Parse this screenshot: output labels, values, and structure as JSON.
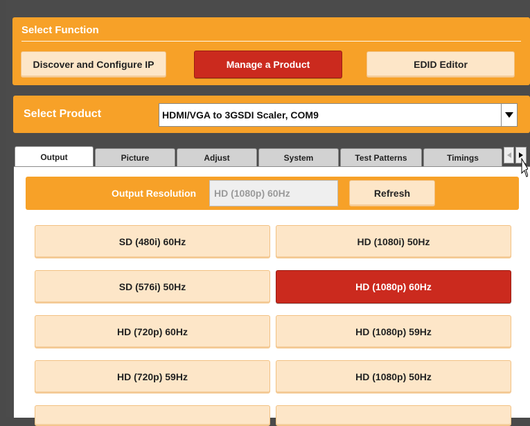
{
  "select_function": {
    "title": "Select Function",
    "buttons": [
      {
        "label": "Discover and Configure IP",
        "active": false
      },
      {
        "label": "Manage a Product",
        "active": true
      },
      {
        "label": "EDID Editor",
        "active": false
      }
    ]
  },
  "select_product": {
    "label": "Select Product",
    "value": "HDMI/VGA to 3GSDI Scaler, COM9"
  },
  "tabs": [
    "Output",
    "Picture",
    "Adjust",
    "System",
    "Test Patterns",
    "Timings"
  ],
  "active_tab": "Output",
  "output": {
    "resolution_label": "Output Resolution",
    "resolution_value": "HD (1080p) 60Hz",
    "refresh_label": "Refresh",
    "resolution_buttons": [
      {
        "label": "SD (480i) 60Hz",
        "selected": false
      },
      {
        "label": "HD (1080i) 50Hz",
        "selected": false
      },
      {
        "label": "SD (576i) 50Hz",
        "selected": false
      },
      {
        "label": "HD (1080p) 60Hz",
        "selected": true
      },
      {
        "label": "HD (720p) 60Hz",
        "selected": false
      },
      {
        "label": "HD (1080p) 59Hz",
        "selected": false
      },
      {
        "label": "HD (720p) 59Hz",
        "selected": false
      },
      {
        "label": "HD (1080p) 50Hz",
        "selected": false
      }
    ]
  },
  "colors": {
    "orange": "#f7a128",
    "selected_red": "#cb2a1e",
    "button_light": "#fde6c8"
  }
}
